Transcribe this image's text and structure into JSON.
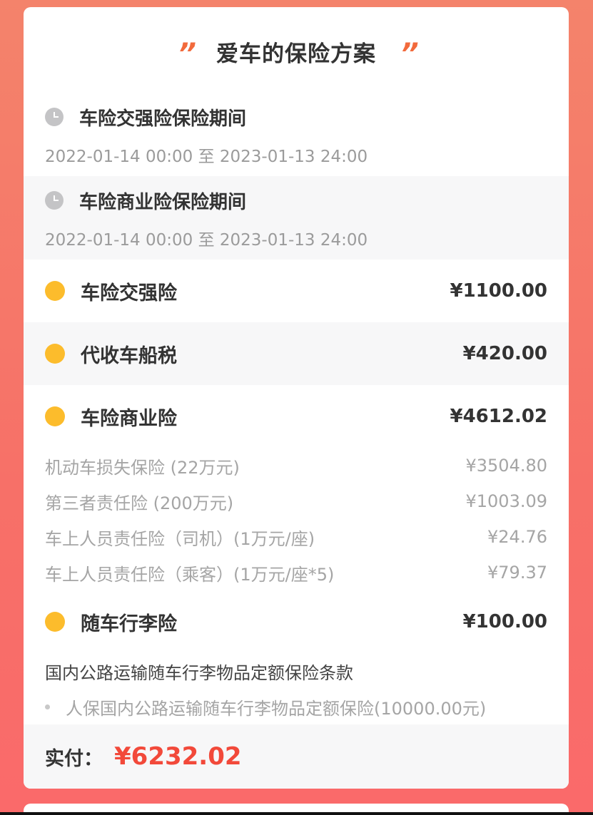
{
  "plan": {
    "title": "爱车的保险方案",
    "quote_mark": "”",
    "periods": [
      {
        "label": "车险交强险保险期间",
        "dates": "2022-01-14 00:00 至 2023-01-13 24:00"
      },
      {
        "label": "车险商业险保险期间",
        "dates": "2022-01-14 00:00 至 2023-01-13 24:00"
      }
    ],
    "items": [
      {
        "label": "车险交强险",
        "amount": "¥1100.00"
      },
      {
        "label": "代收车船税",
        "amount": "¥420.00"
      },
      {
        "label": "车险商业险",
        "amount": "¥4612.02"
      },
      {
        "label": "随车行李险",
        "amount": "¥100.00"
      }
    ],
    "commercial_details": [
      {
        "label": "机动车损失保险 (22万元)",
        "amount": "¥3504.80"
      },
      {
        "label": "第三者责任险 (200万元)",
        "amount": "¥1003.09"
      },
      {
        "label": "车上人员责任险（司机）(1万元/座)",
        "amount": "¥24.76"
      },
      {
        "label": "车上人员责任险（乘客）(1万元/座*5)",
        "amount": "¥79.37"
      }
    ],
    "luggage_clause": {
      "title": "国内公路运输随车行李物品定额保险条款",
      "item": "人保国内公路运输随车行李物品定额保险(10000.00元)"
    },
    "total": {
      "label": "实付：",
      "amount": "¥6232.02"
    }
  },
  "colors": {
    "accent": "#f2493a",
    "quote": "#f26a3c",
    "dot": "#fcbc2c",
    "background_gradient": "#f4836b"
  },
  "icons": {
    "period": "clock-icon",
    "item": "dot-icon",
    "clause": "bullet-icon"
  }
}
